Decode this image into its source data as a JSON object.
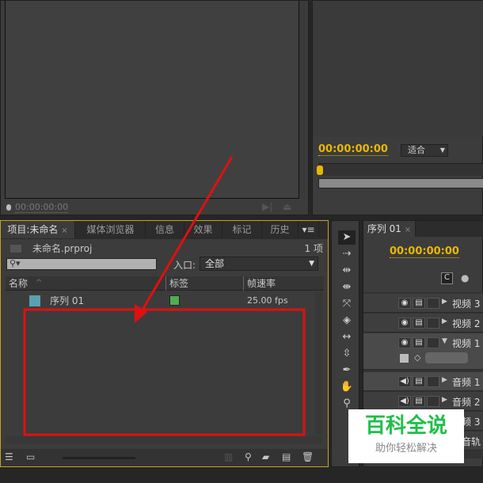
{
  "source_monitor": {
    "timecode": "00:00:00:00"
  },
  "program_monitor": {
    "timecode": "00:00:00:00",
    "zoom_select": "适合"
  },
  "project_panel": {
    "tabs": [
      "项目:未命名",
      "媒体浏览器",
      "信息",
      "效果",
      "标记",
      "历史"
    ],
    "tab_close": "×",
    "project_file": "未命名.prproj",
    "item_count": "1 项",
    "search_placeholder": "",
    "in_label": "入口:",
    "in_select": "全部",
    "columns": [
      "名称",
      "标签",
      "帧速率"
    ],
    "items": [
      {
        "name": "序列 01",
        "label_color": "#4caf50",
        "fps": "25.00 fps"
      }
    ]
  },
  "timeline": {
    "tab": "序列 01",
    "tab_close": "×",
    "timecode": "00:00:00:00",
    "tracks": [
      "视频 3",
      "视频 2",
      "视频 1",
      "音频 1",
      "音频 2",
      "音频 3",
      "主音轨"
    ]
  },
  "watermark": {
    "title": "百科全说",
    "subtitle": "助你轻松解决"
  },
  "colors": {
    "accent": "#e8b800",
    "annotation": "#e01010"
  }
}
